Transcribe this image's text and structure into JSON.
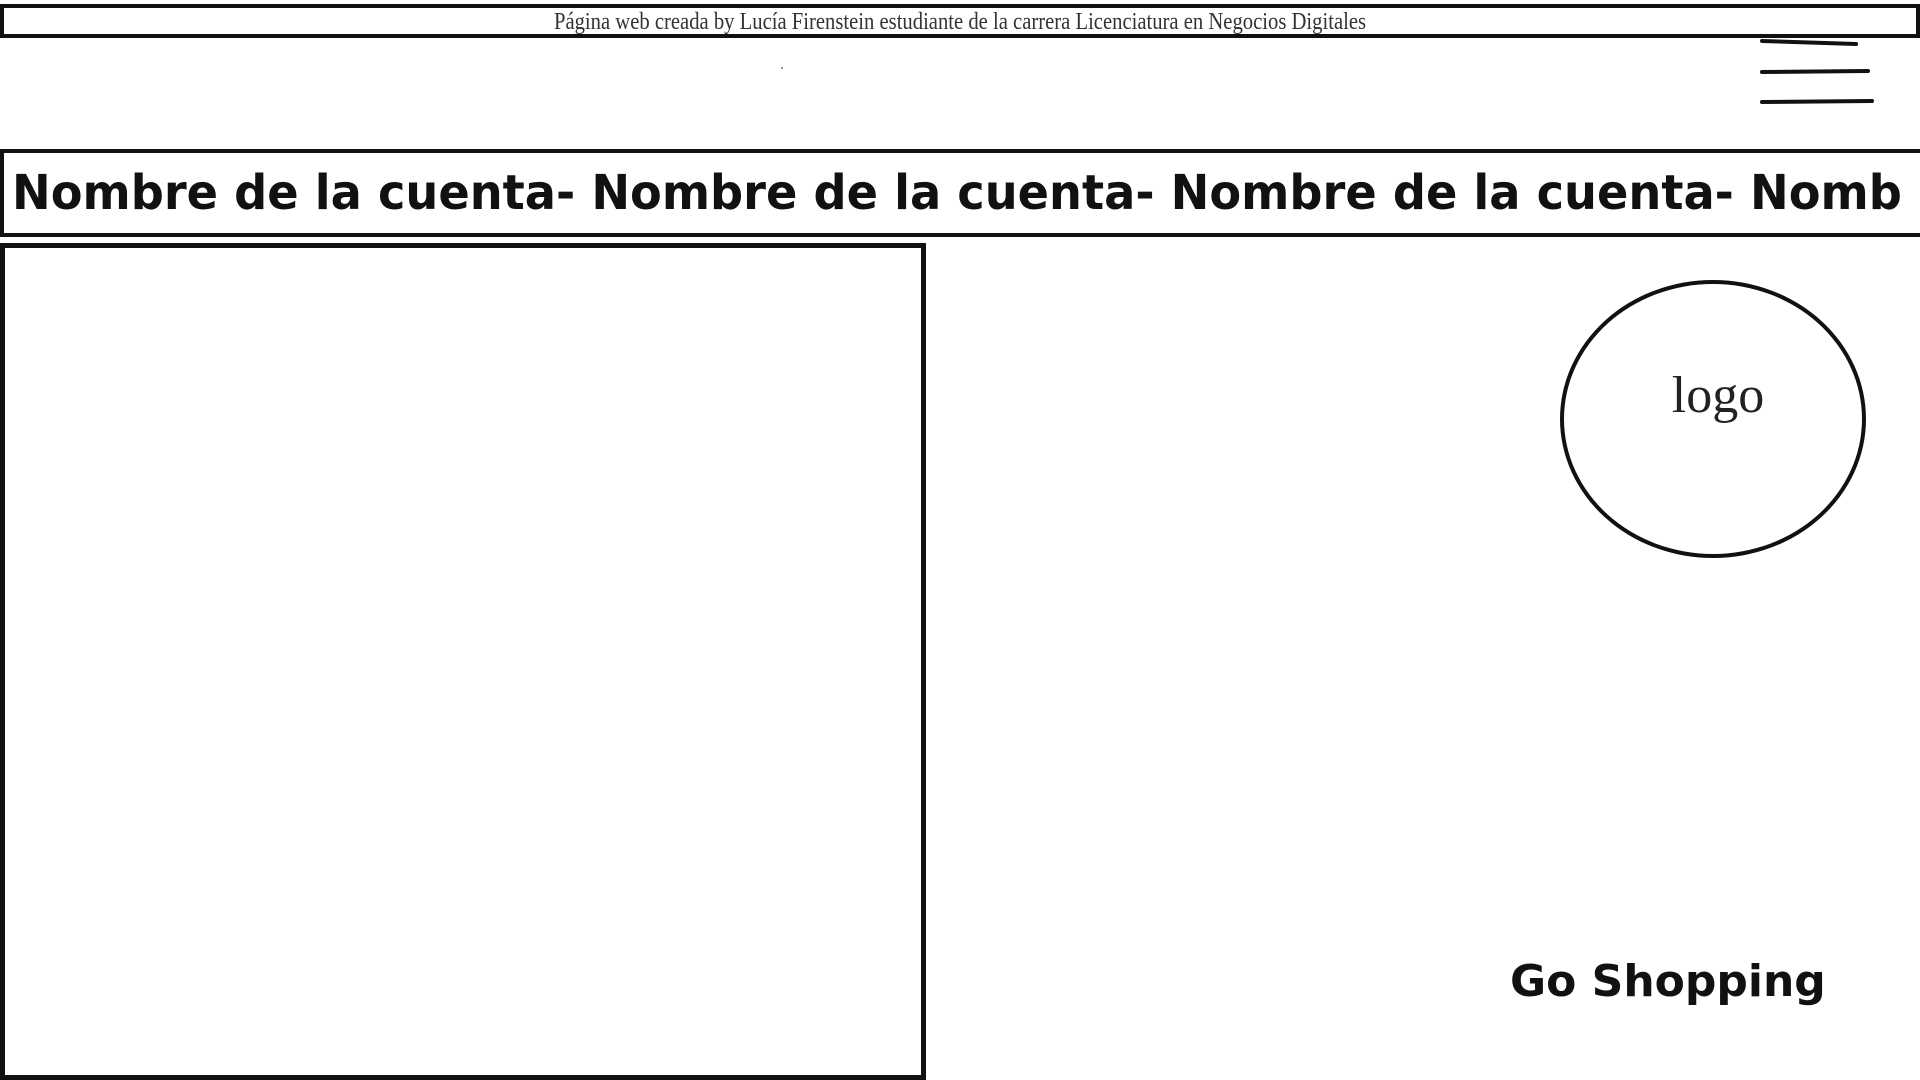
{
  "banner": {
    "text": "Página web creada by Lucía Firenstein estudiante de la carrera Licenciatura en Negocios Digitales"
  },
  "header": {
    "menu_icon": "hamburger-menu-icon"
  },
  "marquee": {
    "text": "Nombre de la cuenta- Nombre  de la cuenta- Nombre de la cuenta- Nomb"
  },
  "hero": {
    "logo_text": "logo",
    "cta_label": "Go Shopping"
  },
  "colors": {
    "ink": "#111111",
    "background": "#ffffff"
  }
}
